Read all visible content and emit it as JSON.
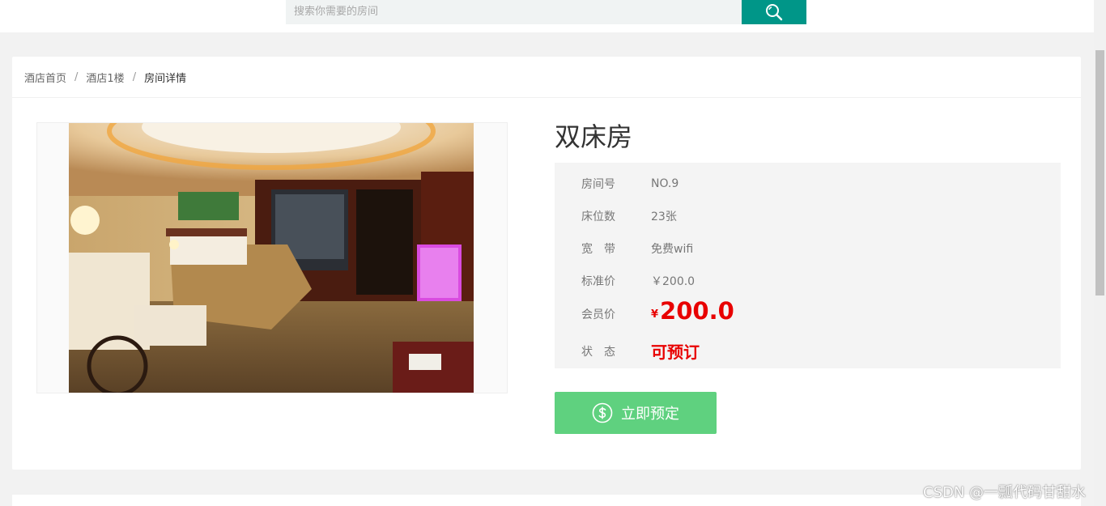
{
  "search": {
    "placeholder": "搜索你需要的房间",
    "button_icon": "search-icon"
  },
  "breadcrumb": {
    "items": [
      "酒店首页",
      "酒店1楼"
    ],
    "separator": "/",
    "current": "房间详情"
  },
  "room": {
    "title": "双床房",
    "fields": {
      "room_no_label": "房间号",
      "room_no": "NO.9",
      "beds_label": "床位数",
      "beds": "23张",
      "broadband_label": "宽　带",
      "broadband": "免费wifi",
      "std_price_label": "标准价",
      "std_price": "￥200.0",
      "member_price_label": "会员价",
      "member_price_symbol": "¥",
      "member_price": "200.0",
      "status_label": "状　态",
      "status": "可预订"
    }
  },
  "actions": {
    "book_label": "立即预定",
    "book_icon": "dollar-circle-icon"
  },
  "watermark": "CSDN @一瓢代码甘甜水",
  "colors": {
    "accent": "#009688",
    "book": "#5fd17f",
    "price_red": "#e80000"
  }
}
